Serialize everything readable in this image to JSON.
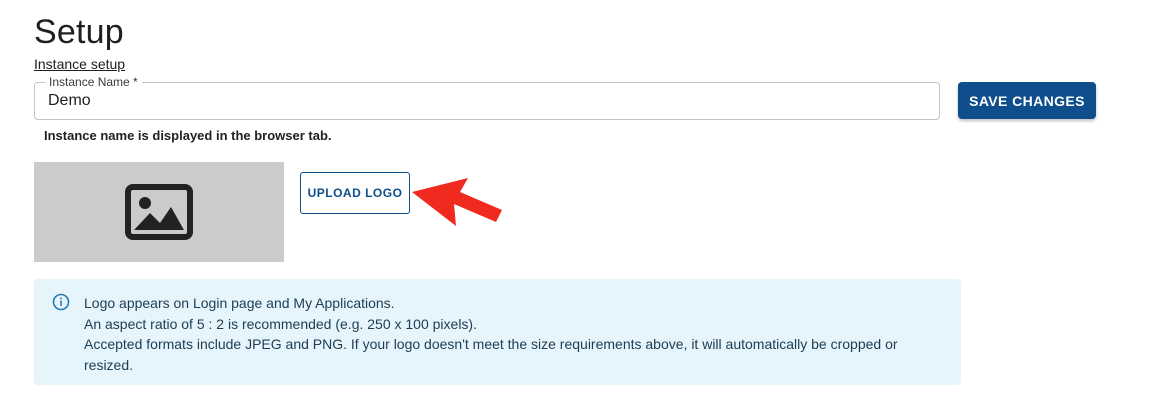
{
  "page": {
    "title": "Setup",
    "breadcrumb": "Instance setup"
  },
  "instance_name": {
    "label": "Instance Name *",
    "value": "Demo",
    "helper": "Instance name is displayed in the browser tab."
  },
  "actions": {
    "save_label": "SAVE CHANGES",
    "upload_label": "UPLOAD LOGO"
  },
  "logo": {
    "placeholder_icon": "image-icon"
  },
  "info": {
    "icon": "info-icon",
    "lines": [
      "Logo appears on Login page and My Applications.",
      "An aspect ratio of 5 : 2 is recommended (e.g. 250 x 100 pixels).",
      "Accepted formats include JPEG and PNG. If your logo doesn't meet the size requirements above, it will automatically be cropped or resized."
    ]
  },
  "colors": {
    "primary": "#0f4e8c",
    "info_background": "#e6f4fb",
    "placeholder_background": "#cbcbcb",
    "annotation_arrow": "#f02a1e"
  }
}
